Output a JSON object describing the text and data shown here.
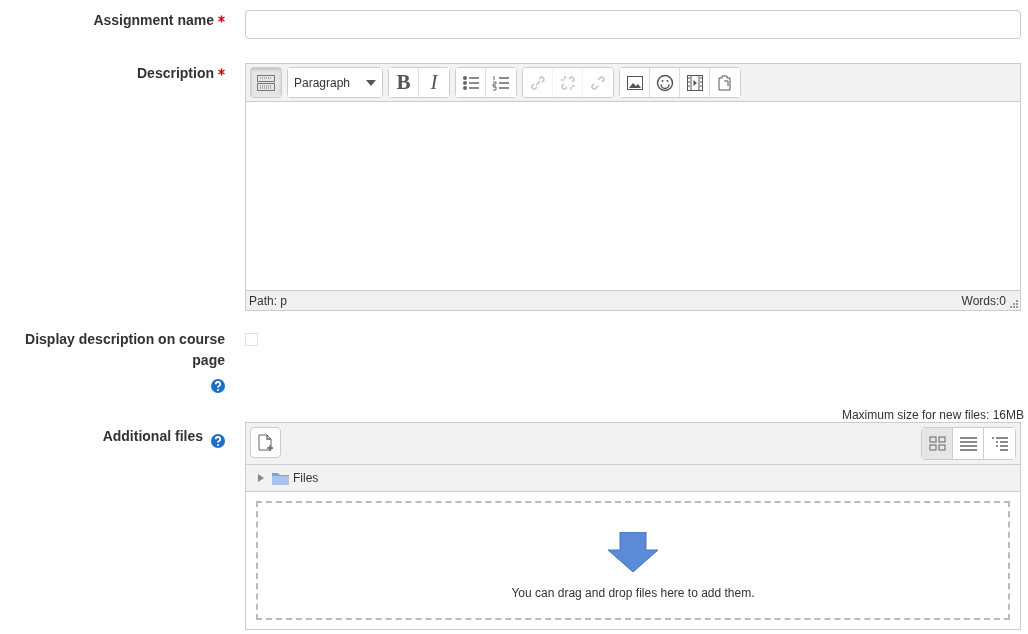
{
  "assignment_name": {
    "label": "Assignment name",
    "required": true
  },
  "description": {
    "label": "Description",
    "required": true,
    "toolbar": [
      [
        {
          "kind": "toggle",
          "pressed": true,
          "disabled": false
        }
      ],
      [
        {
          "kind": "select",
          "value": "Paragraph"
        }
      ],
      [
        {
          "kind": "bold",
          "text": "B",
          "pressed": false,
          "disabled": false
        },
        {
          "kind": "italic",
          "text": "I",
          "pressed": false,
          "disabled": false
        }
      ],
      [
        {
          "kind": "bullets",
          "pressed": false,
          "disabled": false
        },
        {
          "kind": "numbers",
          "pressed": false,
          "disabled": false
        }
      ],
      [
        {
          "kind": "link",
          "pressed": false,
          "disabled": true
        },
        {
          "kind": "unlink",
          "pressed": false,
          "disabled": true
        },
        {
          "kind": "anchor",
          "pressed": false,
          "disabled": true
        }
      ],
      [
        {
          "kind": "image",
          "pressed": false,
          "disabled": false
        },
        {
          "kind": "emoticon",
          "pressed": false,
          "disabled": false
        },
        {
          "kind": "media",
          "pressed": false,
          "disabled": false
        },
        {
          "kind": "paste",
          "pressed": false,
          "disabled": false
        }
      ]
    ],
    "path": "Path: p",
    "words": "Words:0"
  },
  "display_on_course": {
    "label": "Display description on course page",
    "checked": false,
    "help": true
  },
  "additional_files": {
    "label": "Additional files",
    "help": true,
    "max_size": "Maximum size for new files: 16MB",
    "views": [
      {
        "kind": "icons",
        "selected": true
      },
      {
        "kind": "list",
        "selected": false
      },
      {
        "kind": "tree",
        "selected": false
      }
    ],
    "folder": "Files",
    "drop_hint": "You can drag and drop files here to add them."
  }
}
